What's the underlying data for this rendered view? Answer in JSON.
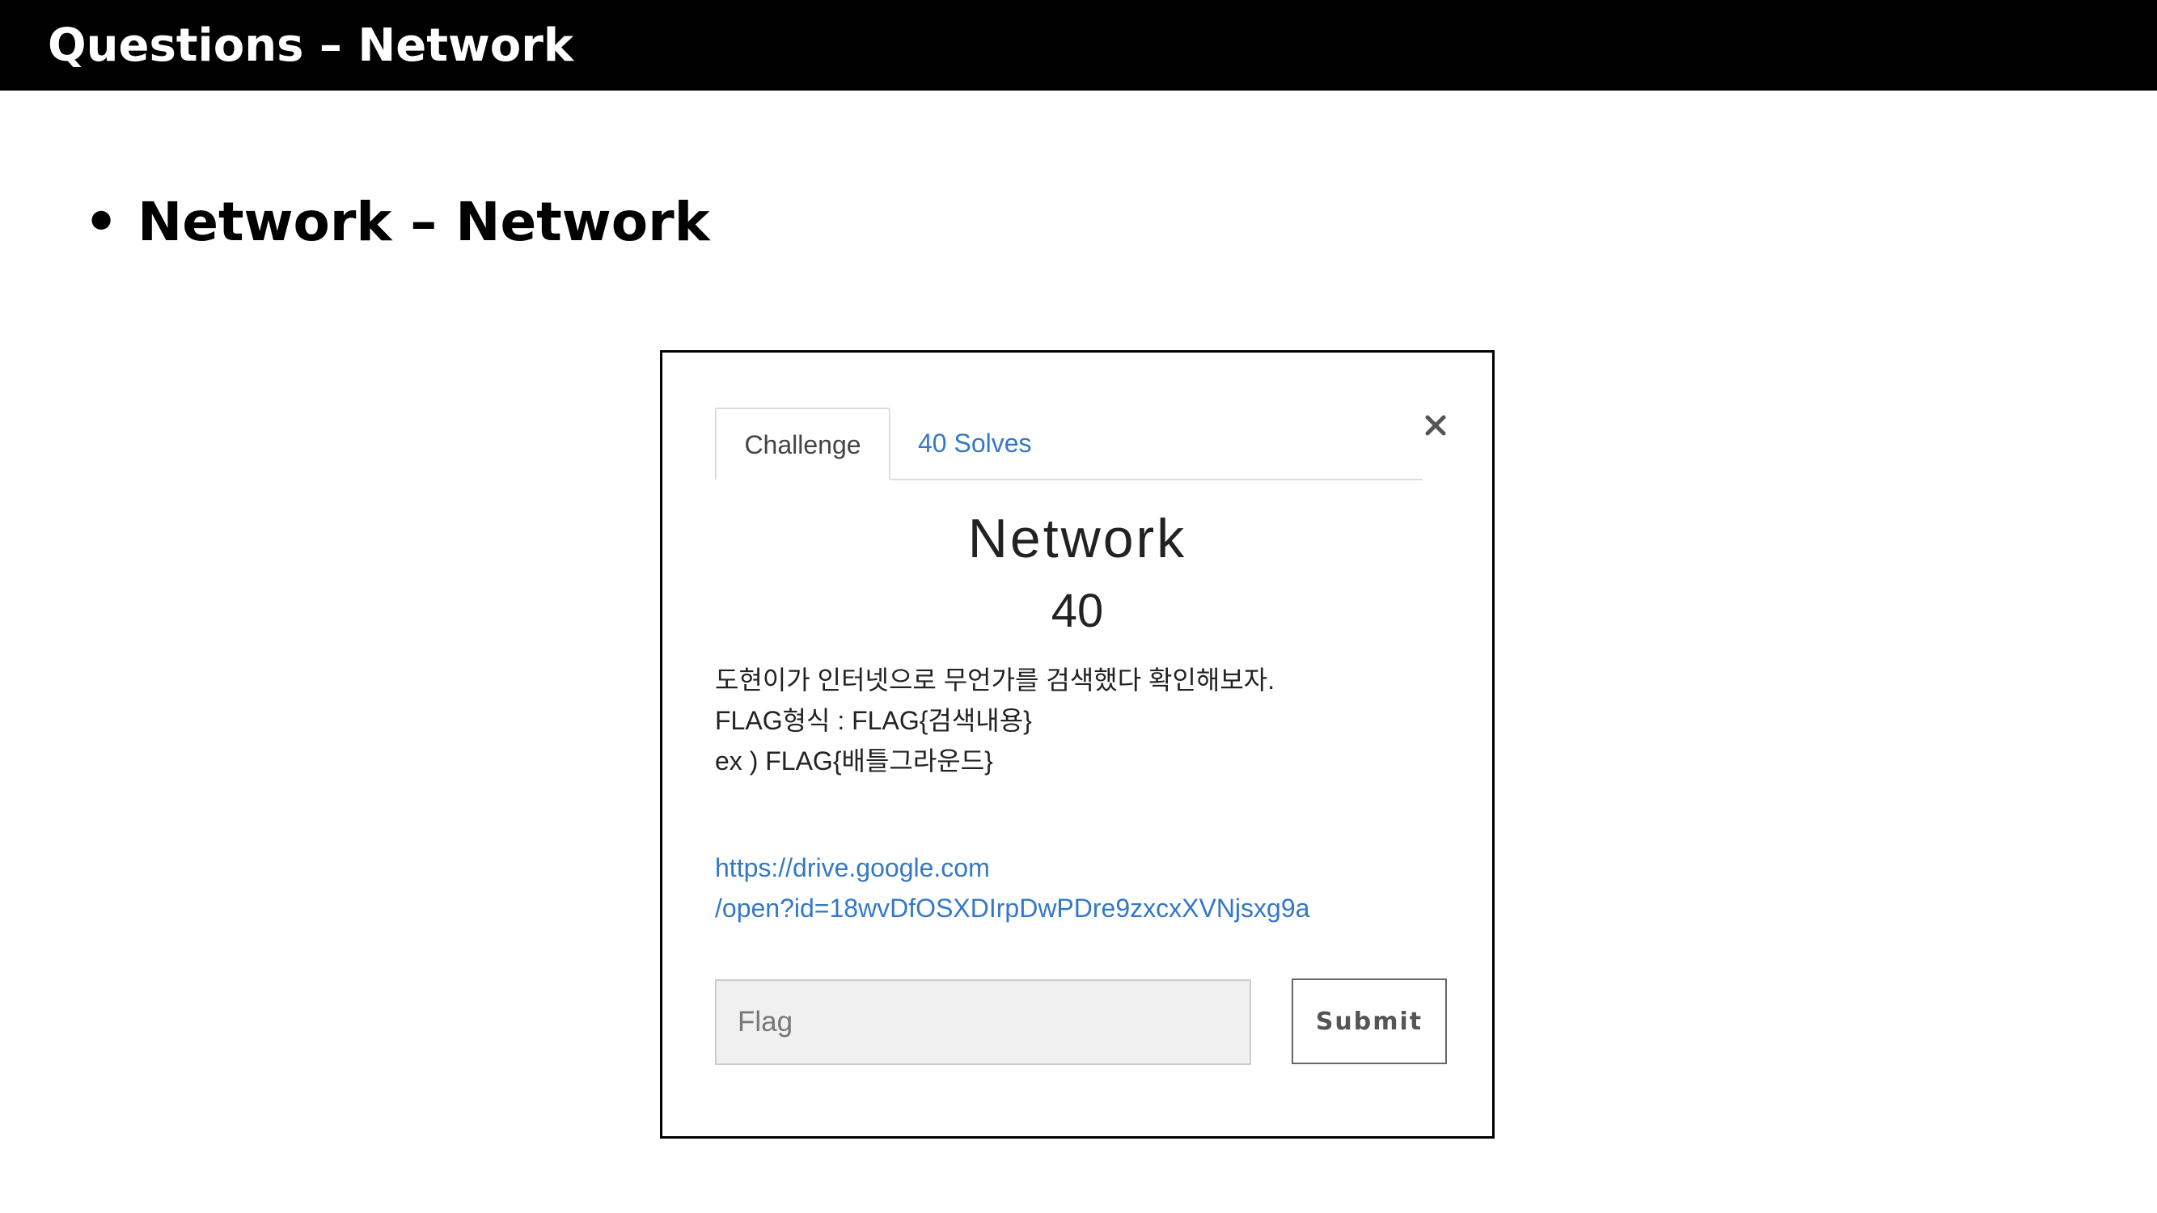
{
  "header": {
    "title": "Questions – Network"
  },
  "section": {
    "bullet": "•",
    "heading": "Network – Network"
  },
  "modal": {
    "tabs": [
      {
        "label": "Challenge",
        "active": true
      },
      {
        "label": "40 Solves",
        "active": false
      }
    ],
    "close_icon": "close-icon",
    "challenge_name": "Network",
    "challenge_value": "40",
    "description": [
      "도현이가 인터넷으로 무언가를 검색했다 확인해보자.",
      "FLAG형식 : FLAG{검색내용}",
      "ex ) FLAG{배틀그라운드}"
    ],
    "link": [
      "https://drive.google.com",
      "/open?id=18wvDfOSXDIrpDwPDre9zxcxXVNjsxg9a"
    ],
    "flag_input": {
      "value": "",
      "placeholder": "Flag"
    },
    "submit_label": "Submit"
  },
  "colors": {
    "header_bg": "#000000",
    "link": "#3478c6",
    "input_bg": "#f0f0f0"
  }
}
